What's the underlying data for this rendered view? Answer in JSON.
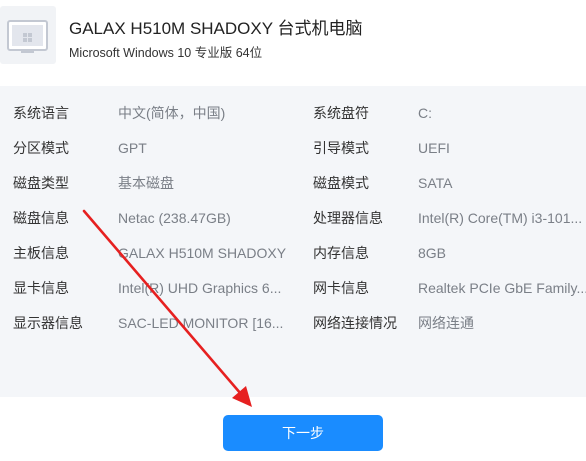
{
  "header": {
    "title": "GALAX H510M SHADOXY 台式机电脑",
    "subtitle": "Microsoft Windows 10 专业版 64位",
    "icon": "desktop-computer-icon"
  },
  "info": {
    "rows": [
      {
        "label_left": "系统语言",
        "value_left": "中文(简体，中国)",
        "label_right": "系统盘符",
        "value_right": "C:"
      },
      {
        "label_left": "分区模式",
        "value_left": "GPT",
        "label_right": "引导模式",
        "value_right": "UEFI"
      },
      {
        "label_left": "磁盘类型",
        "value_left": "基本磁盘",
        "label_right": "磁盘模式",
        "value_right": "SATA"
      },
      {
        "label_left": "磁盘信息",
        "value_left": "Netac (238.47GB)",
        "label_right": "处理器信息",
        "value_right": "Intel(R) Core(TM) i3-101..."
      },
      {
        "label_left": "主板信息",
        "value_left": "GALAX H510M SHADOXY",
        "label_right": "内存信息",
        "value_right": "8GB"
      },
      {
        "label_left": "显卡信息",
        "value_left": "Intel(R) UHD Graphics 6...",
        "label_right": "网卡信息",
        "value_right": "Realtek PCIe GbE Family..."
      },
      {
        "label_left": "显示器信息",
        "value_left": "SAC-LED MONITOR [16...",
        "label_right": "网络连接情况",
        "value_right": "网络连通"
      }
    ]
  },
  "actions": {
    "next_label": "下一步"
  },
  "colors": {
    "accent": "#1a8cff",
    "annotation_arrow": "#e62020",
    "panel_bg": "#f4f6f9"
  }
}
